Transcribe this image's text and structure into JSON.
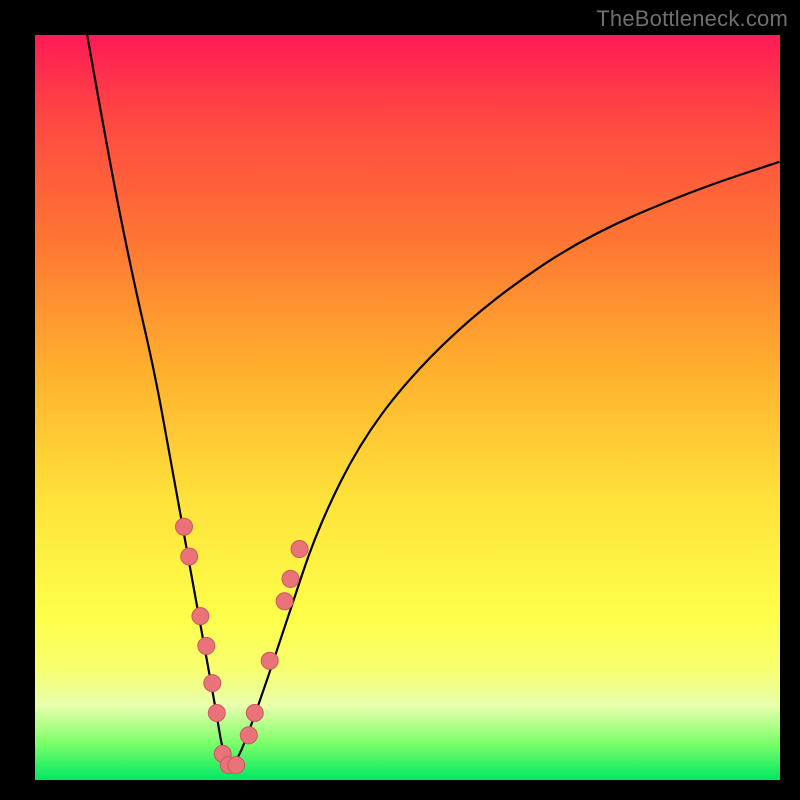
{
  "watermark": "TheBottleneck.com",
  "chart_data": {
    "type": "line",
    "title": "",
    "xlabel": "",
    "ylabel": "",
    "xlim": [
      0,
      100
    ],
    "ylim": [
      0,
      100
    ],
    "note": "V-shaped bottleneck curve; axes unlabeled; gradient background encodes severity (red=bad top, green=good bottom). Values are estimated from pixels on a 0–100 normalized grid.",
    "series": [
      {
        "name": "bottleneck-curve",
        "x": [
          7,
          10,
          13,
          16,
          18,
          20,
          22,
          24,
          25.5,
          27,
          30,
          34,
          38,
          44,
          52,
          62,
          74,
          88,
          100
        ],
        "y": [
          100,
          83,
          68,
          55,
          44,
          33,
          22,
          11,
          2,
          2,
          10,
          22,
          34,
          46,
          56,
          65,
          73,
          79,
          83
        ]
      }
    ],
    "markers": {
      "name": "highlight-beads",
      "note": "salmon circular beads on the curve near the valley",
      "points": [
        {
          "x": 20.0,
          "y": 34
        },
        {
          "x": 20.7,
          "y": 30
        },
        {
          "x": 22.2,
          "y": 22
        },
        {
          "x": 23.0,
          "y": 18
        },
        {
          "x": 23.8,
          "y": 13
        },
        {
          "x": 24.4,
          "y": 9
        },
        {
          "x": 25.2,
          "y": 3.5
        },
        {
          "x": 26.0,
          "y": 2
        },
        {
          "x": 27.0,
          "y": 2
        },
        {
          "x": 28.7,
          "y": 6
        },
        {
          "x": 29.5,
          "y": 9
        },
        {
          "x": 31.5,
          "y": 16
        },
        {
          "x": 33.5,
          "y": 24
        },
        {
          "x": 34.3,
          "y": 27
        },
        {
          "x": 35.5,
          "y": 31
        }
      ]
    },
    "colors": {
      "curve": "#000000",
      "bead_fill": "#e97379",
      "bead_stroke": "#ca5a60",
      "gradient_top": "#ff1a55",
      "gradient_bottom": "#00e864"
    }
  }
}
